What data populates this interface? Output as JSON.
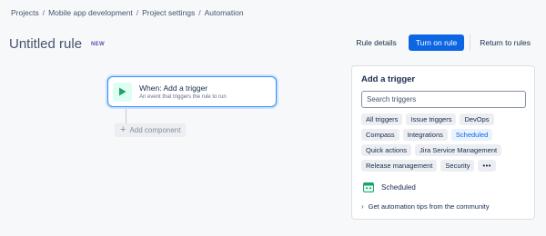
{
  "breadcrumb": [
    "Projects",
    "Mobile app development",
    "Project settings",
    "Automation"
  ],
  "breadcrumb_separator": "/",
  "title": "Untitled rule",
  "badge": "NEW",
  "actions": {
    "rule_details": "Rule details",
    "turn_on": "Turn on rule",
    "return": "Return to rules"
  },
  "trigger": {
    "title": "When: Add a trigger",
    "subtitle": "An event that triggers the rule to run",
    "icon": "play-icon"
  },
  "add_component": "Add component",
  "panel": {
    "heading": "Add a trigger",
    "search_placeholder": "Search triggers",
    "chips": [
      "All triggers",
      "Issue triggers",
      "DevOps",
      "Compass",
      "Integrations",
      "Scheduled",
      "Quick actions",
      "Jira Service Management",
      "Release management",
      "Security"
    ],
    "more_label": "•••",
    "active_chip": "Scheduled",
    "result_label": "Scheduled",
    "tips": "Get automation tips from the community"
  },
  "colors": {
    "primary": "#0c66e4",
    "trigger_border": "#388bff",
    "play_green": "#22a06b"
  }
}
